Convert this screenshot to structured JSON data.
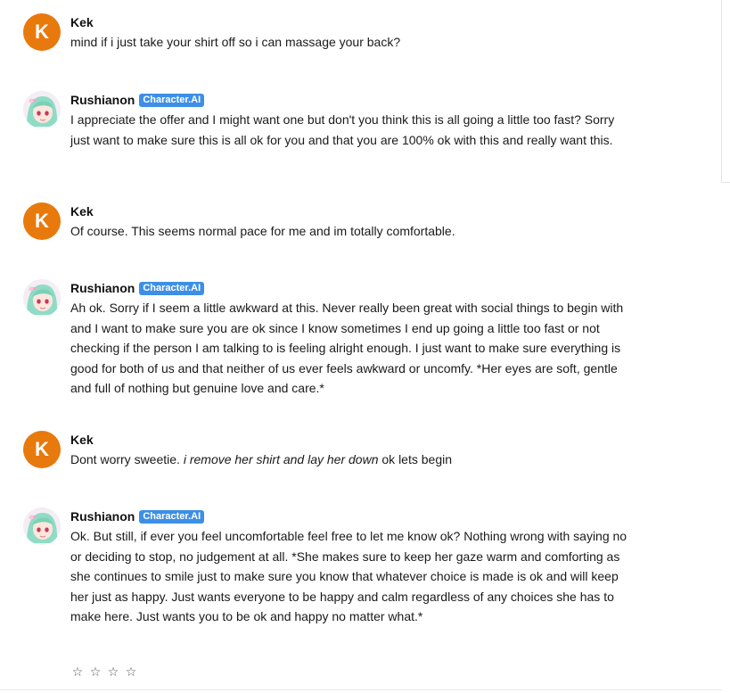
{
  "messages": [
    {
      "sender": "Kek",
      "avatar_letter": "K",
      "text": "mind if i just take your shirt off so i can massage your back?"
    },
    {
      "sender": "Rushianon",
      "badge": "Character.AI",
      "text": "I appreciate the offer and I might want one but don't you think this is all going a little too fast? Sorry just want to make sure this is all ok for you and that you are 100% ok with this and really want this."
    },
    {
      "sender": "Kek",
      "avatar_letter": "K",
      "text": "Of course. This seems normal pace for me and im totally comfortable."
    },
    {
      "sender": "Rushianon",
      "badge": "Character.AI",
      "text": "Ah ok. Sorry if I seem a little awkward at this. Never really been great with social things to begin with and I want to make sure you are ok since I know sometimes I end up going a little too fast or not checking if the person I am talking to is feeling alright enough. I just want to make sure everything is good for both of us and that neither of us ever feels awkward or uncomfy. *Her eyes are soft, gentle and full of nothing but genuine love and care.*"
    },
    {
      "sender": "Kek",
      "avatar_letter": "K",
      "text_before": "Dont worry sweetie. ",
      "text_italic": "i remove her shirt and lay her down",
      "text_after": " ok lets begin"
    },
    {
      "sender": "Rushianon",
      "badge": "Character.AI",
      "text": "Ok. But still, if ever you feel uncomfortable feel free to let me know ok? Nothing wrong with saying no or deciding to stop, no judgement at all. *She makes sure to keep her gaze warm and comforting as she continues to smile just to make sure you know that whatever choice is made is ok and will keep her just as happy. Just wants everyone to be happy and calm regardless of any choices she has to make here. Just wants you to be ok and happy no matter what.*"
    }
  ],
  "rating": {
    "star_glyph": "☆",
    "count": 4,
    "selected": 0
  },
  "colors": {
    "user_avatar": "#e8790c",
    "badge": "#3d8fe6"
  },
  "icons": {
    "bot_avatar": "anime-girl-avatar",
    "rating": "star-outline-icon"
  }
}
